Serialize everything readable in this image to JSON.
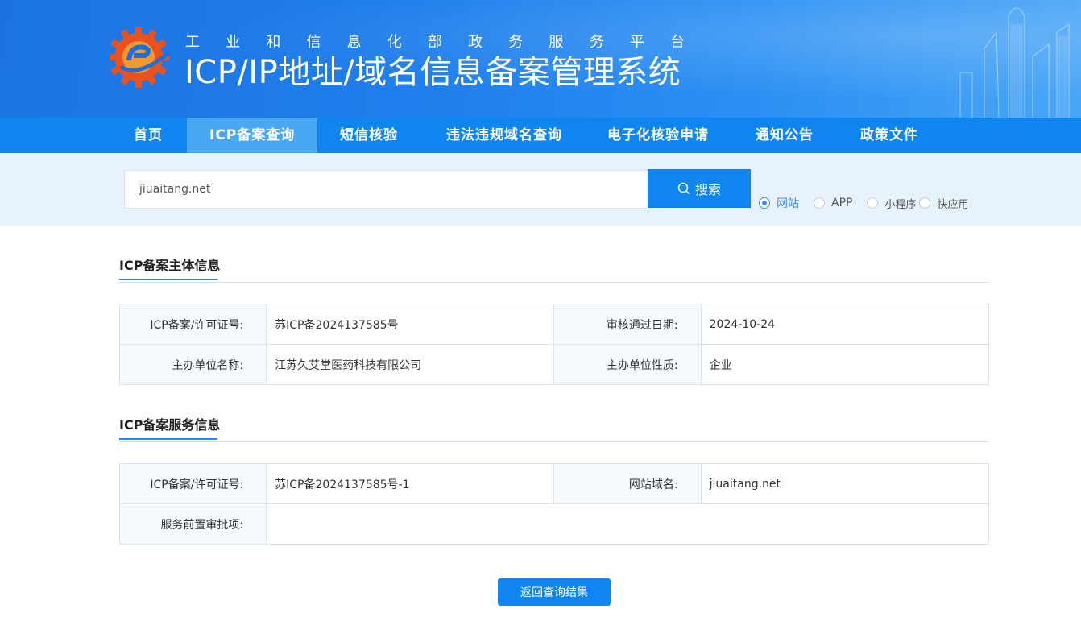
{
  "header": {
    "subtitle_chars": [
      "工",
      "业",
      "和",
      "信",
      "息",
      "化",
      "部",
      "政",
      "务",
      "服",
      "务",
      "平",
      "台"
    ],
    "title": "ICP/IP地址/域名信息备案管理系统"
  },
  "nav": {
    "items": [
      {
        "label": "首页"
      },
      {
        "label": "ICP备案查询"
      },
      {
        "label": "短信核验"
      },
      {
        "label": "违法违规域名查询"
      },
      {
        "label": "电子化核验申请"
      },
      {
        "label": "通知公告"
      },
      {
        "label": "政策文件"
      }
    ],
    "active_index": 1
  },
  "search": {
    "value": "jiuaitang.net",
    "button_label": "搜索",
    "types": [
      {
        "label": "网站",
        "checked": true
      },
      {
        "label": "APP",
        "checked": false
      },
      {
        "label": "小程序",
        "checked": false
      },
      {
        "label": "快应用",
        "checked": false
      }
    ]
  },
  "subject_info": {
    "title": "ICP备案主体信息",
    "license_key": "ICP备案/许可证号:",
    "license_value": "苏ICP备2024137585号",
    "approve_date_key": "审核通过日期:",
    "approve_date_value": "2024-10-24",
    "org_name_key": "主办单位名称:",
    "org_name_value": "江苏久艾堂医药科技有限公司",
    "org_type_key": "主办单位性质:",
    "org_type_value": "企业"
  },
  "service_info": {
    "title": "ICP备案服务信息",
    "license_key": "ICP备案/许可证号:",
    "license_value": "苏ICP备2024137585号-1",
    "domain_key": "网站域名:",
    "domain_value": "jiuaitang.net",
    "pre_approval_key": "服务前置审批项:",
    "pre_approval_value": ""
  },
  "back_button_label": "返回查询结果",
  "colors": {
    "primary": "#0f85ef",
    "nav_active": "#48a8f4",
    "search_band": "#e7f2fc"
  }
}
